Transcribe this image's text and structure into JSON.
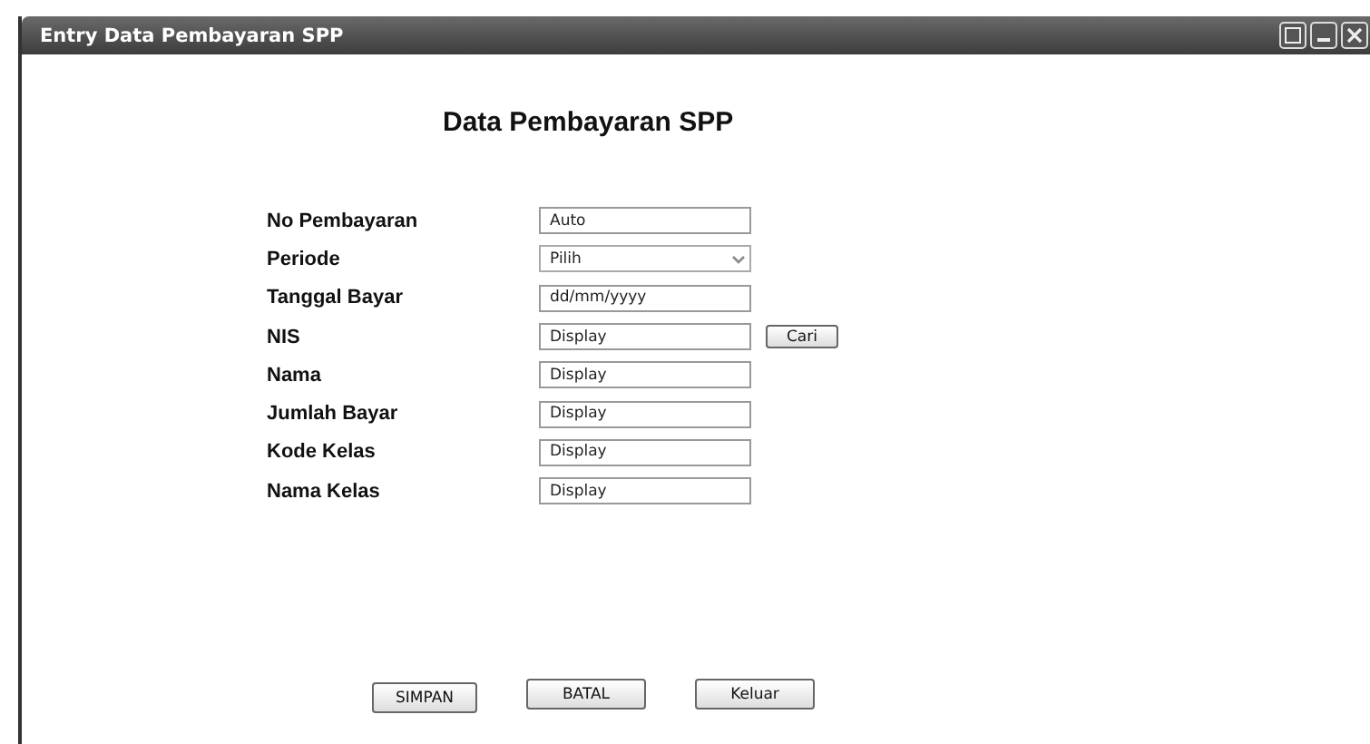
{
  "window": {
    "title": "Entry Data Pembayaran SPP"
  },
  "heading": "Data Pembayaran SPP",
  "fields": [
    {
      "label": "No Pembayaran",
      "kind": "text",
      "value": "Auto"
    },
    {
      "label": "Periode",
      "kind": "select",
      "value": "Pilih"
    },
    {
      "label": "Tanggal Bayar",
      "kind": "text",
      "placeholder": "dd/mm/yyyy"
    },
    {
      "label": "NIS",
      "kind": "text",
      "value": "Display",
      "button": "Cari"
    },
    {
      "label": "Nama",
      "kind": "text",
      "value": "Display"
    },
    {
      "label": "Jumlah Bayar",
      "kind": "text",
      "value": "Display"
    },
    {
      "label": "Kode Kelas",
      "kind": "text",
      "value": "Display"
    },
    {
      "label": "Nama Kelas",
      "kind": "text",
      "value": "Display"
    }
  ],
  "buttons": [
    "SIMPAN",
    "BATAL",
    "Keluar"
  ]
}
